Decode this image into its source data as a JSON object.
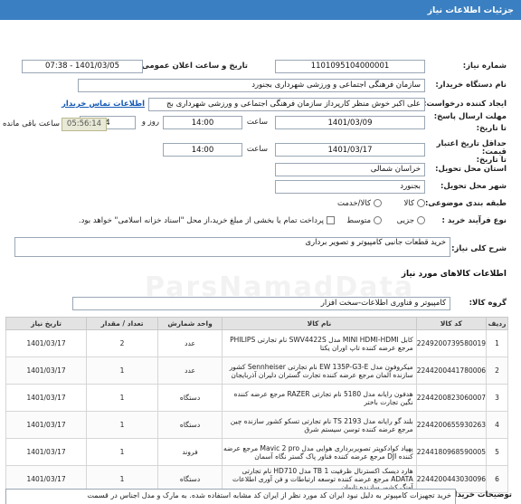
{
  "header": {
    "title": "جزئیات اطلاعات نیاز"
  },
  "need_number": {
    "label": "شماره نیاز:",
    "value": "1101095104000001"
  },
  "announce": {
    "label": "تاریخ و ساعت اعلان عمومی:",
    "value": "1401/03/05 - 07:38"
  },
  "buyer_org": {
    "label": "نام دستگاه خریدار:",
    "value": "سازمان فرهنگی اجتماعی و ورزشی شهرداری بجنورد"
  },
  "requester": {
    "label": "ایجاد کننده درخواست:",
    "value": "علی اکبر خوش منظر کارپرداز سازمان فرهنگی اجتماعی و ورزشی شهرداری بج",
    "contact_link": "اطلاعات تماس خریدار"
  },
  "deadline": {
    "label1": "مهلت ارسال پاسخ:",
    "label2": "تا تاریخ:",
    "date": "1401/03/09",
    "time_label": "ساعت",
    "time": "14:00",
    "days": "4",
    "days_label": "روز و",
    "remaining": "05:56:14",
    "remaining_label": "ساعت باقی مانده"
  },
  "validity": {
    "label1": "حداقل تاریخ اعتبار",
    "label2": "قیمت:",
    "label3": "تا تاریخ:",
    "date": "1401/03/17",
    "time_label": "ساعت",
    "time": "14:00"
  },
  "province": {
    "label": "استان محل تحویل:",
    "value": "خراسان شمالی"
  },
  "city": {
    "label": "شهر محل تحویل:",
    "value": "بجنورد"
  },
  "category": {
    "label": "طبقه بندی موضوعی:",
    "opt1": "کالا",
    "opt2": "کالا/خدمت"
  },
  "process": {
    "label": "نوع فرآیند خرید :",
    "opt1": "جزیی",
    "opt2": "متوسط",
    "note": "پرداخت تمام یا بخشی از مبلغ خرید،از محل \"اسناد خزانه اسلامی\" خواهد بود."
  },
  "summary": {
    "label": "شرح کلی نیاز:",
    "value": "خرید قطعات جانبی کامپیوتر و تصویر برداری"
  },
  "goods_title": "اطلاعات کالاهای مورد نیاز",
  "goods_group": {
    "label": "گروه کالا:",
    "value": "کامپیوتر و فناوری اطلاعات-سخت افزار"
  },
  "table": {
    "headers": [
      "ردیف",
      "کد کالا",
      "نام کالا",
      "واحد شمارش",
      "تعداد / مقدار",
      "تاریخ نیاز"
    ],
    "rows": [
      {
        "n": "1",
        "code": "2249200739580019",
        "name": "کابل MINI HDMI-HDMI مدل SWV4422S نام تجارتی PHILIPS مرجع عرضه کننده تاپ اوران یکتا",
        "unit": "عدد",
        "qty": "2",
        "date": "1401/03/17"
      },
      {
        "n": "2",
        "code": "2244200441780006",
        "name": "میکروفون مدل EW 135P-G3-E نام تجارتی Sennheiser کشور سازنده آلمان مرجع عرضه کننده تجارت گستران دلیران آذربایجان",
        "unit": "عدد",
        "qty": "1",
        "date": "1401/03/17"
      },
      {
        "n": "3",
        "code": "2244200823060007",
        "name": "هدفون رایانه مدل 5180 نام تجارتی RAZER مرجع عرضه کننده نگین تجارت باختر",
        "unit": "دستگاه",
        "qty": "1",
        "date": "1401/03/17"
      },
      {
        "n": "4",
        "code": "2244200655930263",
        "name": "بلند گو رایانه مدل TS 2193 نام تجارتی تسکو کشور سازنده چین مرجع عرضه کننده توسن سیستم شرق",
        "unit": "دستگاه",
        "qty": "1",
        "date": "1401/03/17"
      },
      {
        "n": "5",
        "code": "2244180968590005",
        "name": "پهپاد کوادکوپتر تصویربرداری هوایی مدل Mavic 2 pro مرجع عرضه کننده DJI مرجع عرضه کننده فناور پاک گستر نگاه آسمان",
        "unit": "فروند",
        "qty": "1",
        "date": "1401/03/17"
      },
      {
        "n": "6",
        "code": "2244200443030096",
        "name": "هارد دیسک اکسترنال ظرفیت 1 TB مدل HD710 نام تجارتی ADATA مرجع عرضه کننده توسعه ارتباطات و فن آوری اطلاعات آونگ کشور سازنده تایوان",
        "unit": "دستگاه",
        "qty": "1",
        "date": "1401/03/17"
      }
    ]
  },
  "buyer_desc": {
    "label": "توضیحات خریدار:",
    "value": "خرید تجهیزات کامپیوتر به دلیل نبود ایران کد مورد نظر از ایران کد مشابه استفاده شده. به مارک و مدل اجناس در قسمت"
  },
  "watermark": "ParsNamadData"
}
